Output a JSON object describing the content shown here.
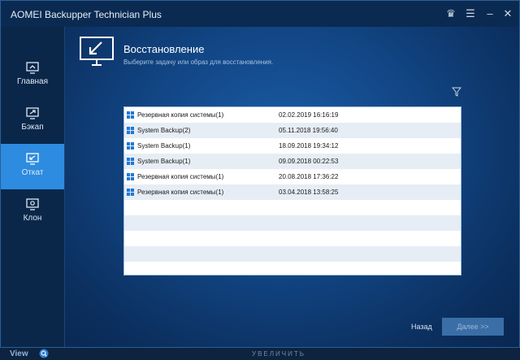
{
  "window": {
    "title": "AOMEI Backupper Technician Plus"
  },
  "sidebar": {
    "items": [
      {
        "label": "Главная",
        "icon": "home-icon"
      },
      {
        "label": "Бэкап",
        "icon": "backup-icon"
      },
      {
        "label": "Откат",
        "icon": "restore-icon",
        "active": true
      },
      {
        "label": "Клон",
        "icon": "clone-icon"
      }
    ]
  },
  "main": {
    "title": "Восстановление",
    "subtitle": "Выберите задачу или образ для восстановления."
  },
  "backups": [
    {
      "name": "Резервная копия системы(1)",
      "date": "02.02.2019 16:16:19"
    },
    {
      "name": "System Backup(2)",
      "date": "05.11.2018 19:56:40"
    },
    {
      "name": "System Backup(1)",
      "date": "18.09.2018 19:34:12"
    },
    {
      "name": "System Backup(1)",
      "date": "09.09.2018 00:22:53"
    },
    {
      "name": "Резервная копия системы(1)",
      "date": "20.08.2018 17:36:22"
    },
    {
      "name": "Резервная копия системы(1)",
      "date": "03.04.2018 13:58:25"
    }
  ],
  "footer": {
    "back_label": "Назад",
    "next_label": "Далее >>"
  },
  "statusbar": {
    "view_label": "View",
    "magnify_label": "УВЕЛИЧИТЬ"
  },
  "colors": {
    "accent": "#2d8be0",
    "window_bg": "#0b2c55",
    "table_stripe": "#e6edf5"
  }
}
